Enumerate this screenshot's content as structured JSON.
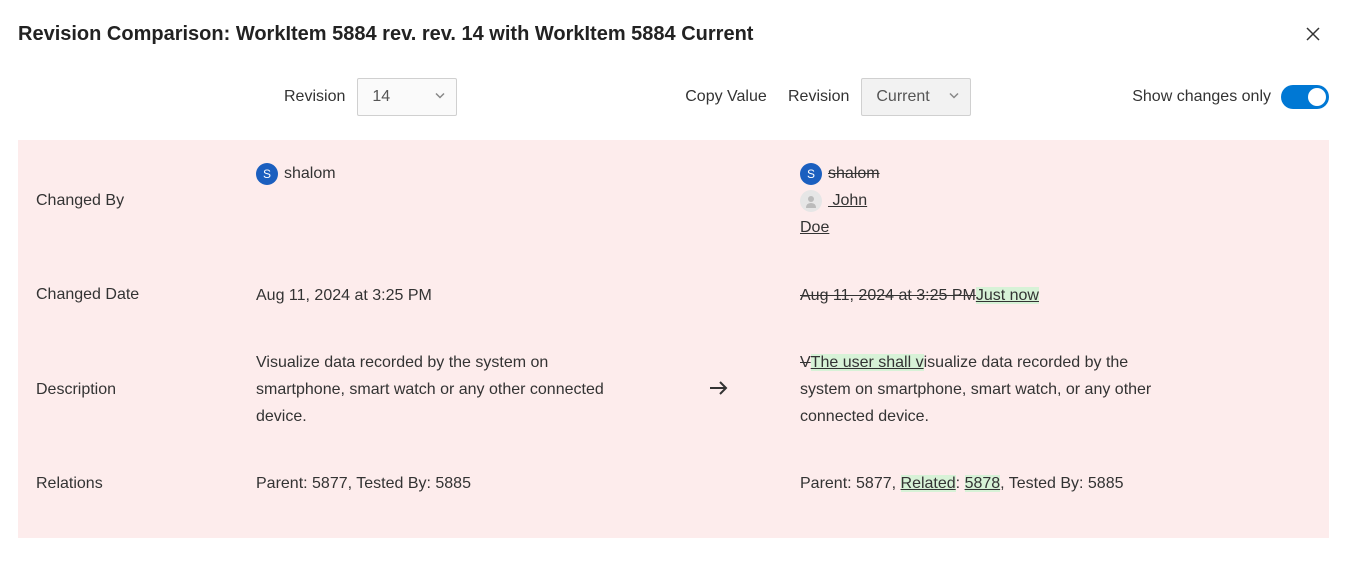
{
  "header": {
    "title": "Revision Comparison: WorkItem 5884 rev. rev. 14 with WorkItem 5884 Current"
  },
  "toolbar": {
    "revision_label_left": "Revision",
    "revision_value_left": "14",
    "copy_value_label": "Copy Value",
    "revision_label_right": "Revision",
    "revision_value_right": "Current",
    "show_changes_only_label": "Show changes only"
  },
  "rows": {
    "changed_by": {
      "label": "Changed By",
      "left": {
        "avatar_letter": "S",
        "name": "shalom"
      },
      "right": {
        "removed_avatar_letter": "S",
        "removed_name": "shalom",
        "added_name_line1": " John",
        "added_name_line2": "Doe"
      }
    },
    "changed_date": {
      "label": "Changed Date",
      "left": "Aug 11, 2024 at 3:25 PM",
      "right_removed": "Aug 11, 2024 at 3:25 PM",
      "right_added": "Just now"
    },
    "description": {
      "label": "Description",
      "left": "Visualize data recorded by the system on smartphone, smart watch or any other connected device.",
      "right_del": "V",
      "right_ins": "The user shall v",
      "right_rest": "isualize data recorded by the system on smartphone, smart watch, or any other connected device."
    },
    "relations": {
      "label": "Relations",
      "left": "Parent: 5877, Tested By: 5885",
      "right_prefix": "Parent: 5877, ",
      "right_related_label": "Related",
      "right_colon": ": ",
      "right_related_id": "5878",
      "right_suffix": ", Tested By: 5885"
    }
  }
}
